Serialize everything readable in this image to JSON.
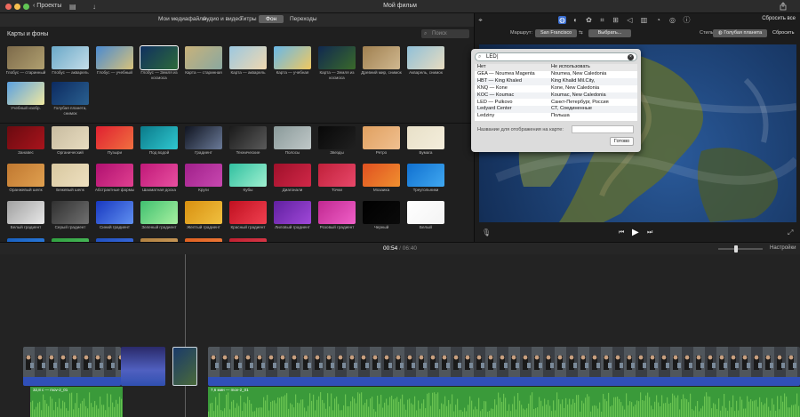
{
  "window": {
    "title": "Мой фильм",
    "back_label": "Проекты",
    "colors": {
      "close": "#ed6a5e",
      "min": "#f5bf4f",
      "max": "#61c554"
    }
  },
  "browser_tabs": [
    {
      "label": "Мои медиафайлы",
      "selected": false
    },
    {
      "label": "Аудио и видео",
      "selected": false
    },
    {
      "label": "Титры",
      "selected": false
    },
    {
      "label": "Фон",
      "selected": true
    },
    {
      "label": "Переходы",
      "selected": false
    }
  ],
  "browser": {
    "section_title": "Карты и фоны",
    "search_placeholder": "Поиск",
    "maps": [
      {
        "label": "Глобус — старинный",
        "colors": [
          "#7d6a4a",
          "#b0a070"
        ]
      },
      {
        "label": "Глобус — акварель",
        "colors": [
          "#6aa8c8",
          "#c4dde8"
        ]
      },
      {
        "label": "Глобус — учебный",
        "colors": [
          "#4a8ad0",
          "#d8c27a"
        ]
      },
      {
        "label": "Глобус — Земля из космоса",
        "colors": [
          "#103060",
          "#2d6a3a"
        ]
      },
      {
        "label": "Карта — старинная",
        "colors": [
          "#c8b27a",
          "#8aa8a0"
        ]
      },
      {
        "label": "Карта — акварель",
        "colors": [
          "#9cc8e0",
          "#f0d8b0"
        ]
      },
      {
        "label": "Карта — учебная",
        "colors": [
          "#68b8e8",
          "#f0c860"
        ]
      },
      {
        "label": "Карта — Земля из космоса",
        "colors": [
          "#102850",
          "#3a6a2a"
        ]
      },
      {
        "label": "Древний мир, снимок",
        "colors": [
          "#a08050",
          "#d0b890"
        ]
      },
      {
        "label": "Акварель, снимок",
        "colors": [
          "#90c0d8",
          "#e8dcc0"
        ]
      },
      {
        "label": "Учебный изобр.",
        "colors": [
          "#5aa0e0",
          "#f0e8a0"
        ]
      },
      {
        "label": "Голубая планета, снимок",
        "colors": [
          "#0c2a60",
          "#2a6090"
        ]
      }
    ],
    "backgrounds": [
      {
        "label": "Занавес",
        "colors": [
          "#6a0a10",
          "#a8141c"
        ]
      },
      {
        "label": "Органический",
        "colors": [
          "#c8bca0",
          "#e8dcc0"
        ]
      },
      {
        "label": "Пузыри",
        "colors": [
          "#e02030",
          "#f07040"
        ]
      },
      {
        "label": "Под водой",
        "colors": [
          "#0a7a8a",
          "#30c8d0"
        ]
      },
      {
        "label": "Градиент",
        "colors": [
          "#101420",
          "#6a7a98"
        ]
      },
      {
        "label": "Технические",
        "colors": [
          "#1a1a1a",
          "#5a5a5a"
        ]
      },
      {
        "label": "Полосы",
        "colors": [
          "#8a9a9a",
          "#c0c8c8"
        ]
      },
      {
        "label": "Звезды",
        "colors": [
          "#080808",
          "#202020"
        ]
      },
      {
        "label": "Ретро",
        "colors": [
          "#e0a060",
          "#f0c090"
        ]
      },
      {
        "label": "Бумага",
        "colors": [
          "#e8e0c8",
          "#f4eedc"
        ]
      },
      {
        "label": "Оранжевый шелк",
        "colors": [
          "#c07830",
          "#e0a050"
        ]
      },
      {
        "label": "Бежевый шелк",
        "colors": [
          "#d8c8a0",
          "#eee0c0"
        ]
      },
      {
        "label": "Абстрактные формы",
        "colors": [
          "#b01070",
          "#e04090"
        ]
      },
      {
        "label": "Шахматная доска",
        "colors": [
          "#c01878",
          "#e850a0"
        ]
      },
      {
        "label": "Круги",
        "colors": [
          "#a0208a",
          "#c848b0"
        ]
      },
      {
        "label": "Кубы",
        "colors": [
          "#30c0a0",
          "#a0f0d0"
        ]
      },
      {
        "label": "Диагонали",
        "colors": [
          "#a0102a",
          "#d02848"
        ]
      },
      {
        "label": "Точки",
        "colors": [
          "#c0203a",
          "#e8486a"
        ]
      },
      {
        "label": "Мозаика",
        "colors": [
          "#e05020",
          "#f09030"
        ]
      },
      {
        "label": "Треугольники",
        "colors": [
          "#1070d0",
          "#40a8f0"
        ]
      },
      {
        "label": "Белый градиент",
        "colors": [
          "#a0a0a0",
          "#e8e8e8"
        ]
      },
      {
        "label": "Серый градиент",
        "colors": [
          "#303030",
          "#707070"
        ]
      },
      {
        "label": "Синий градиент",
        "colors": [
          "#1838c0",
          "#6090f0"
        ]
      },
      {
        "label": "Зеленый градиент",
        "colors": [
          "#40c070",
          "#a8f0a0"
        ]
      },
      {
        "label": "Желтый градиент",
        "colors": [
          "#d89010",
          "#f0c040"
        ]
      },
      {
        "label": "Красный градиент",
        "colors": [
          "#c01020",
          "#f04050"
        ]
      },
      {
        "label": "Лиловый градиент",
        "colors": [
          "#6020a0",
          "#a048d8"
        ]
      },
      {
        "label": "Розовый градиент",
        "colors": [
          "#c02890",
          "#f060c8"
        ]
      },
      {
        "label": "Черный",
        "colors": [
          "#000000",
          "#0a0a0a"
        ]
      },
      {
        "label": "Белый",
        "colors": [
          "#ffffff",
          "#f4f4f4"
        ]
      },
      {
        "label": "",
        "colors": [
          "#1860c0",
          "#3080e0"
        ]
      },
      {
        "label": "",
        "colors": [
          "#30a040",
          "#50c060"
        ]
      },
      {
        "label": "",
        "colors": [
          "#2050c0",
          "#4070e0"
        ]
      },
      {
        "label": "",
        "colors": [
          "#b08040",
          "#d0a060"
        ]
      },
      {
        "label": "",
        "colors": [
          "#e06020",
          "#f08040"
        ]
      },
      {
        "label": "",
        "colors": [
          "#c02030",
          "#e04050"
        ]
      }
    ]
  },
  "viewer": {
    "reset_all_label": "Сбросить все",
    "route_label": "Маршрут:",
    "route_from": "San Francisco",
    "route_to": "Выбрать...",
    "style_label": "Стиль:",
    "style_value": "Голубая планета",
    "reset_label": "Сбросить"
  },
  "popover": {
    "search_value": "LED",
    "rows": [
      {
        "code": "Нет",
        "name": "Не использовать",
        "header": true
      },
      {
        "code": "GEA — Noumea Magenta",
        "name": "Noumea, New Caledonia"
      },
      {
        "code": "HBT — King Khaled",
        "name": "King Khalid Mil.City,"
      },
      {
        "code": "KNQ — Kone",
        "name": "Kone, New Caledonia"
      },
      {
        "code": "KOC — Koumac",
        "name": "Koumac, New Caledonia"
      },
      {
        "code": "LED — Pulkovo",
        "name": "Санкт-Петербург, Россия"
      },
      {
        "code": "Ledyard Center",
        "name": "CT, Соединенные"
      },
      {
        "code": "Ledziny",
        "name": "Польша"
      }
    ],
    "display_label": "Название для отображения на карте:",
    "done_label": "Готово"
  },
  "timeline": {
    "current": "00:54",
    "separator": "/",
    "total": "06:40",
    "settings_label": "Настройки",
    "audio_clips": [
      {
        "label": "32,8 с — mov-2_01"
      },
      {
        "label": "7,6 мин — mov-2_01"
      }
    ]
  }
}
